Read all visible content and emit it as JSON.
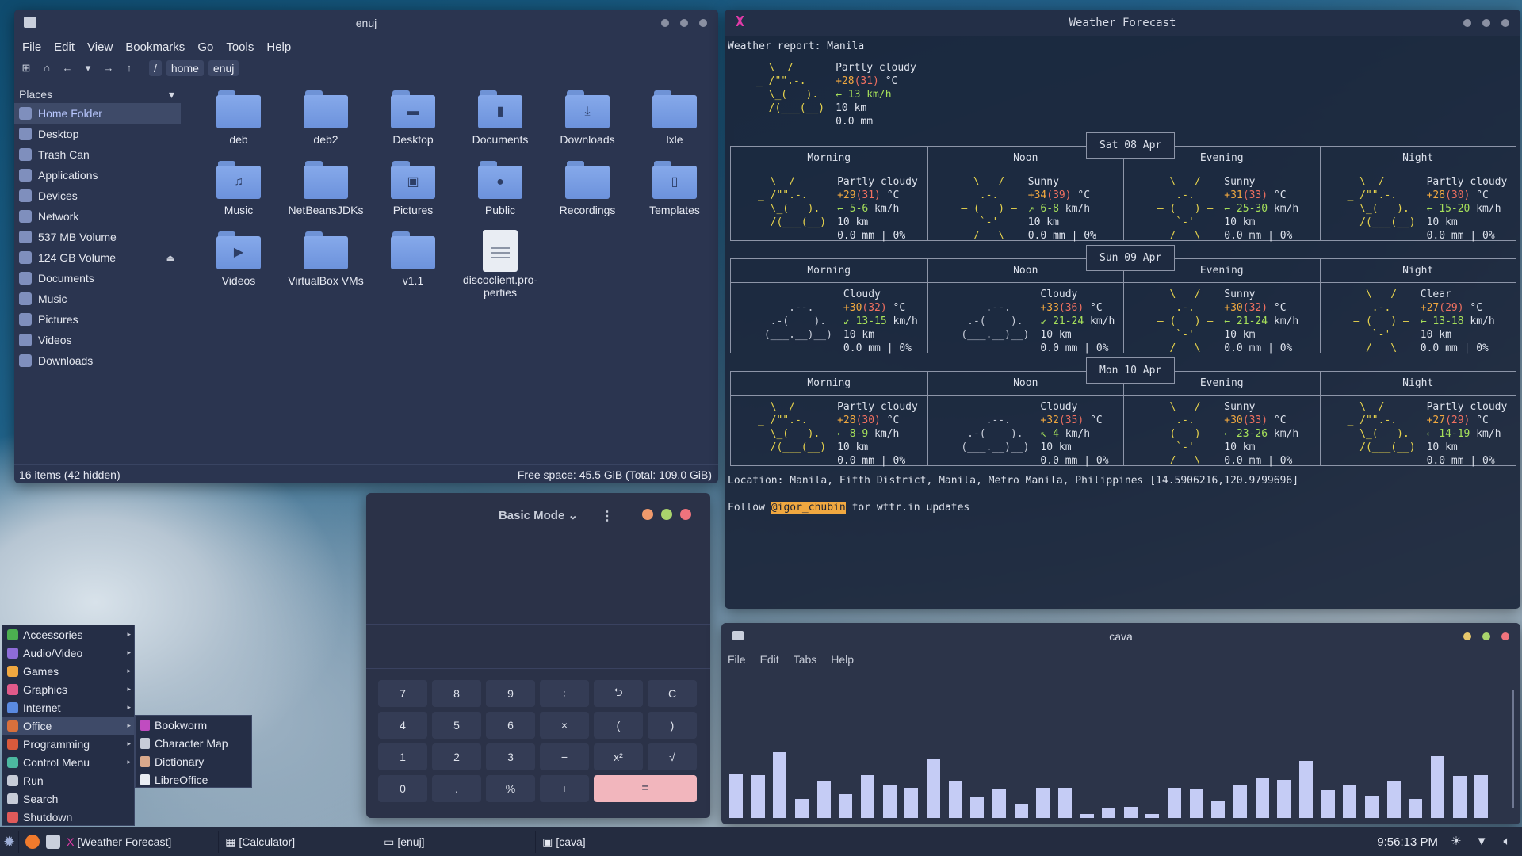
{
  "file_manager": {
    "title": "enuj",
    "menu": [
      "File",
      "Edit",
      "View",
      "Bookmarks",
      "Go",
      "Tools",
      "Help"
    ],
    "breadcrumb": [
      "/",
      "home",
      "enuj"
    ],
    "places_title": "Places",
    "places": [
      {
        "label": "Home Folder",
        "icon": "home-icon",
        "active": true
      },
      {
        "label": "Desktop",
        "icon": "desktop-icon"
      },
      {
        "label": "Trash Can",
        "icon": "trash-icon"
      },
      {
        "label": "Applications",
        "icon": "apps-icon"
      },
      {
        "label": "Devices",
        "icon": "devices-icon"
      },
      {
        "label": "Network",
        "icon": "network-icon"
      },
      {
        "label": "537 MB Volume",
        "icon": "drive-icon"
      },
      {
        "label": "124 GB Volume",
        "icon": "drive-icon",
        "eject": true
      },
      {
        "label": "Documents",
        "icon": "folder-icon"
      },
      {
        "label": "Music",
        "icon": "music-icon"
      },
      {
        "label": "Pictures",
        "icon": "pictures-icon"
      },
      {
        "label": "Videos",
        "icon": "videos-icon"
      },
      {
        "label": "Downloads",
        "icon": "downloads-icon"
      }
    ],
    "files": [
      {
        "label": "deb",
        "type": "folder"
      },
      {
        "label": "deb2",
        "type": "folder"
      },
      {
        "label": "Desktop",
        "type": "folder",
        "emblem": "desktop"
      },
      {
        "label": "Documents",
        "type": "folder",
        "emblem": "doc"
      },
      {
        "label": "Downloads",
        "type": "folder",
        "emblem": "download"
      },
      {
        "label": "lxle",
        "type": "folder"
      },
      {
        "label": "Music",
        "type": "folder",
        "emblem": "music"
      },
      {
        "label": "NetBeansJDKs",
        "type": "folder"
      },
      {
        "label": "Pictures",
        "type": "folder",
        "emblem": "picture"
      },
      {
        "label": "Public",
        "type": "folder",
        "emblem": "person"
      },
      {
        "label": "Recordings",
        "type": "folder"
      },
      {
        "label": "Templates",
        "type": "folder",
        "emblem": "template"
      },
      {
        "label": "Videos",
        "type": "folder",
        "emblem": "video"
      },
      {
        "label": "VirtualBox VMs",
        "type": "folder"
      },
      {
        "label": "v1.1",
        "type": "folder"
      },
      {
        "label": "discoclient.pro-perties",
        "type": "file"
      }
    ],
    "status_left": "16 items (42 hidden)",
    "status_right": "Free space: 45.5 GiB (Total: 109.0 GiB)"
  },
  "weather": {
    "title": "Weather Forecast",
    "header": "Weather report: Manila",
    "current": {
      "desc": "Partly cloudy",
      "temp": "+28",
      "feels": "(31)",
      "unit": " °C",
      "wind": "← 13 km/h",
      "vis": "10 km",
      "precip": "0.0 mm"
    },
    "periods": [
      "Morning",
      "Noon",
      "Evening",
      "Night"
    ],
    "days": [
      {
        "label": "Sat 08 Apr",
        "cells": [
          {
            "art": "pc",
            "desc": "Partly cloudy",
            "temp": "+29",
            "feels": "(31)",
            "wind": "← 5-6",
            "vis": "10 km",
            "precip": "0.0 mm | 0%"
          },
          {
            "art": "sun",
            "desc": "Sunny",
            "temp": "+34",
            "feels": "(39)",
            "wind": "↗ 6-8",
            "vis": "10 km",
            "precip": "0.0 mm | 0%"
          },
          {
            "art": "sun",
            "desc": "Sunny",
            "temp": "+31",
            "feels": "(33)",
            "wind": "← 25-30",
            "vis": "10 km",
            "precip": "0.0 mm | 0%"
          },
          {
            "art": "pc",
            "desc": "Partly cloudy",
            "temp": "+28",
            "feels": "(30)",
            "wind": "← 15-20",
            "vis": "10 km",
            "precip": "0.0 mm | 0%"
          }
        ]
      },
      {
        "label": "Sun 09 Apr",
        "cells": [
          {
            "art": "cloud",
            "desc": "Cloudy",
            "temp": "+30",
            "feels": "(32)",
            "wind": "↙ 13-15",
            "vis": "10 km",
            "precip": "0.0 mm | 0%"
          },
          {
            "art": "cloud",
            "desc": "Cloudy",
            "temp": "+33",
            "feels": "(36)",
            "wind": "↙ 21-24",
            "vis": "10 km",
            "precip": "0.0 mm | 0%"
          },
          {
            "art": "sun",
            "desc": "Sunny",
            "temp": "+30",
            "feels": "(32)",
            "wind": "← 21-24",
            "vis": "10 km",
            "precip": "0.0 mm | 0%"
          },
          {
            "art": "sun",
            "desc": "Clear",
            "temp": "+27",
            "feels": "(29)",
            "wind": "← 13-18",
            "vis": "10 km",
            "precip": "0.0 mm | 0%"
          }
        ]
      },
      {
        "label": "Mon 10 Apr",
        "cells": [
          {
            "art": "pc",
            "desc": "Partly cloudy",
            "temp": "+28",
            "feels": "(30)",
            "wind": "← 8-9",
            "vis": "10 km",
            "precip": "0.0 mm | 0%"
          },
          {
            "art": "cloud",
            "desc": "Cloudy",
            "temp": "+32",
            "feels": "(35)",
            "wind": "↖ 4",
            "vis": "10 km",
            "precip": "0.0 mm | 0%"
          },
          {
            "art": "sun",
            "desc": "Sunny",
            "temp": "+30",
            "feels": "(33)",
            "wind": "← 23-26",
            "vis": "10 km",
            "precip": "0.0 mm | 0%"
          },
          {
            "art": "pc",
            "desc": "Partly cloudy",
            "temp": "+27",
            "feels": "(29)",
            "wind": "← 14-19",
            "vis": "10 km",
            "precip": "0.0 mm | 0%"
          }
        ]
      }
    ],
    "unit": " °C",
    "wind_unit": " km/h",
    "location": "Location: Manila, Fifth District, Manila, Metro Manila, Philippines [14.5906216,120.9799696]",
    "follow_pre": "Follow ",
    "follow_handle": "@igor_chubin",
    "follow_post": " for wttr.in updates"
  },
  "calculator": {
    "mode": "Basic Mode",
    "keys": [
      "7",
      "8",
      "9",
      "÷",
      "⮌",
      "C",
      "4",
      "5",
      "6",
      "×",
      "(",
      ")",
      "1",
      "2",
      "3",
      "−",
      "x²",
      "√",
      "0",
      ".",
      "%",
      "+",
      "="
    ],
    "dot_colors": [
      "#f09a6c",
      "#a9d46c",
      "#f0737d"
    ]
  },
  "cava": {
    "title": "cava",
    "menu": [
      "File",
      "Edit",
      "Tabs",
      "Help"
    ],
    "bar_levels": [
      0.47,
      0.45,
      0.69,
      0.2,
      0.39,
      0.25,
      0.45,
      0.35,
      0.32,
      0.62,
      0.39,
      0.22,
      0.3,
      0.14,
      0.32,
      0.32,
      0.04,
      0.1,
      0.12,
      0.04,
      0.32,
      0.3,
      0.18,
      0.34,
      0.42,
      0.4,
      0.6,
      0.29,
      0.35,
      0.23,
      0.38,
      0.2,
      0.65,
      0.44,
      0.45
    ]
  },
  "start_menu": {
    "items": [
      {
        "label": "Accessories",
        "sub": true,
        "color": "#4caf50"
      },
      {
        "label": "Audio/Video",
        "sub": true,
        "color": "#8e6cd8"
      },
      {
        "label": "Games",
        "sub": true,
        "color": "#f0a840"
      },
      {
        "label": "Graphics",
        "sub": true,
        "color": "#e05a8a"
      },
      {
        "label": "Internet",
        "sub": true,
        "color": "#5a8ae0"
      },
      {
        "label": "Office",
        "sub": true,
        "color": "#d8703c",
        "active": true
      },
      {
        "label": "Programming",
        "sub": true,
        "color": "#d85a3c"
      },
      {
        "label": "Control Menu",
        "sub": true,
        "color": "#4cb8a0"
      },
      {
        "label": "Run",
        "sub": false,
        "color": "#c7ccd8"
      },
      {
        "label": "Search",
        "sub": false,
        "color": "#c7ccd8"
      },
      {
        "label": "Shutdown",
        "sub": false,
        "color": "#e05a5a"
      }
    ],
    "submenu": [
      {
        "label": "Bookworm",
        "color": "#c04cc0"
      },
      {
        "label": "Character Map",
        "color": "#c7ccd8"
      },
      {
        "label": "Dictionary",
        "color": "#d8a88c"
      },
      {
        "label": "LibreOffice",
        "color": "#e9edf3"
      }
    ]
  },
  "taskbar": {
    "tasks": [
      "[Weather Forecast]",
      "[Calculator]",
      "[enuj]",
      "[cava]"
    ],
    "clock": "9:56:13 PM"
  }
}
